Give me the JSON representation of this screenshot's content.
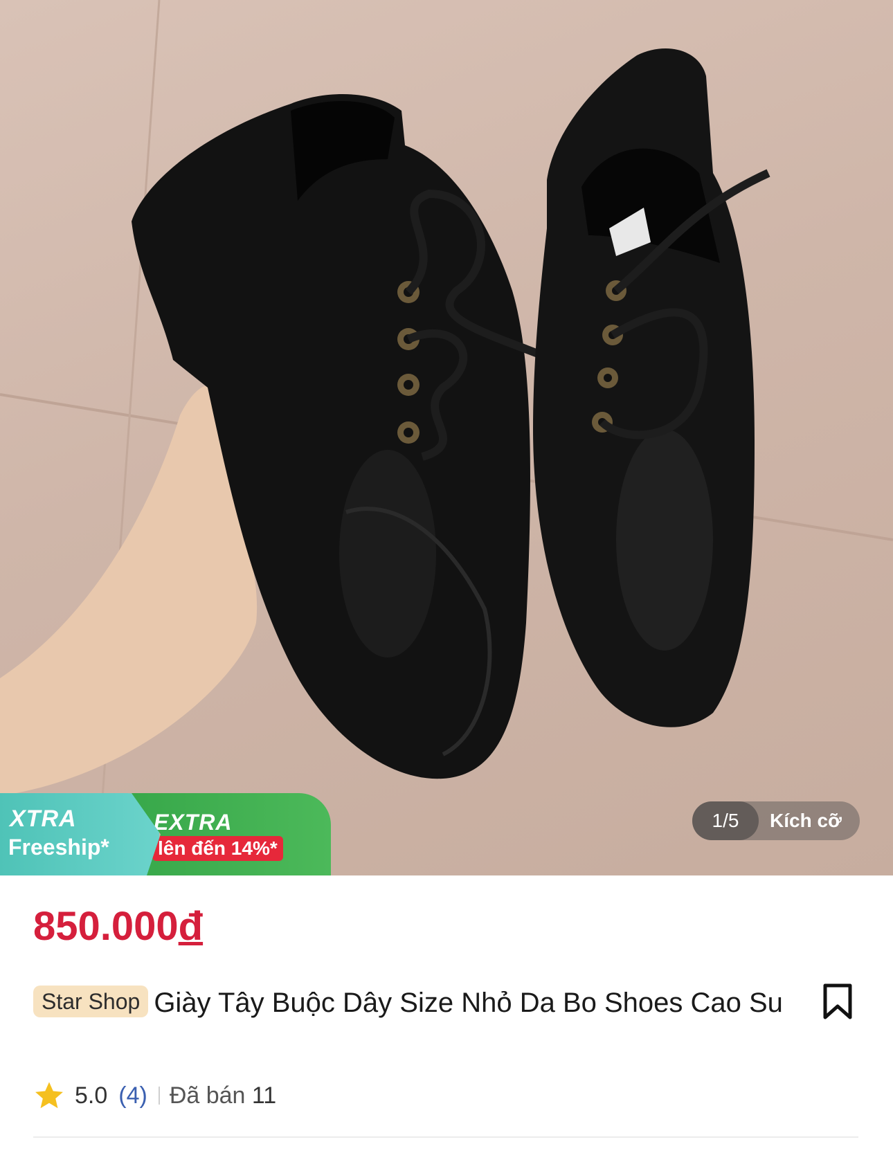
{
  "promo": {
    "xtra_label": "XTRA",
    "freeship_label": "Freeship*",
    "extra_label": "EXTRA",
    "discount_label": "lên đến 14%*"
  },
  "gallery": {
    "page_indicator": "1/5",
    "size_button": "Kích cỡ"
  },
  "product": {
    "price": "850.000",
    "currency": "đ",
    "shop_badge": "Star Shop",
    "title": "Giày Tây Buộc Dây Size Nhỏ Da Bo Shoes Cao Su",
    "rating": "5.0",
    "review_count": "(4)",
    "sold_label": "Đã bán",
    "sold_count": "11"
  },
  "colors": {
    "price": "#d51f3c",
    "xtra_bg": "#4fc3b7",
    "extra_bg": "#38a84a",
    "shop_badge_bg": "#f7e2c0",
    "review_count": "#3a5fb0"
  },
  "icons": {
    "bookmark": "bookmark-icon",
    "star": "star-icon"
  }
}
